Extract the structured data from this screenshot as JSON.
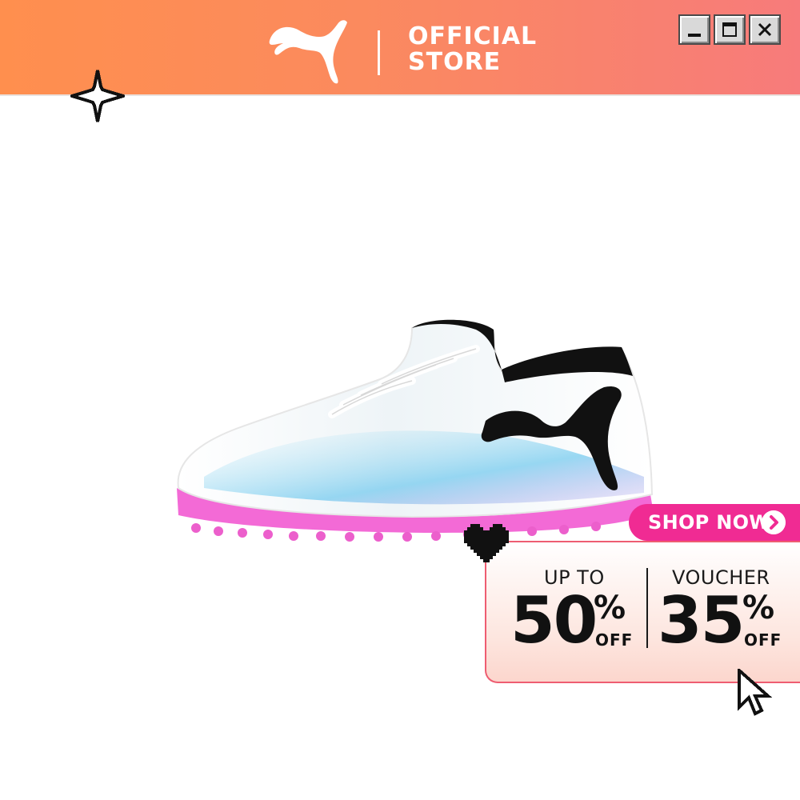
{
  "header": {
    "brand_text_line1": "OFFICIAL",
    "brand_text_line2": "STORE",
    "logo_icon": "puma-cat-logo-icon",
    "gradient_start": "#ff8f4e",
    "gradient_end": "#f77b7b"
  },
  "window_controls": {
    "minimize_icon": "minimize-icon",
    "maximize_icon": "maximize-icon",
    "close_icon": "close-icon"
  },
  "promo": {
    "shop_now_label": "SHOP NOW",
    "shop_now_color": "#f02b93",
    "left_line1": "UP TO",
    "left_value": "50",
    "left_pct": "%",
    "left_off": "OFF",
    "right_line1": "VOUCHER",
    "right_value": "35",
    "right_pct": "%",
    "right_off": "OFF"
  },
  "decorations": {
    "sparkle_icon": "sparkle-icon",
    "heart_icon": "pixel-heart-icon",
    "cursor_icon": "pointer-cursor-icon"
  },
  "product": {
    "image_icon": "football-turf-shoe-image",
    "sole_color": "#f36ad6"
  }
}
